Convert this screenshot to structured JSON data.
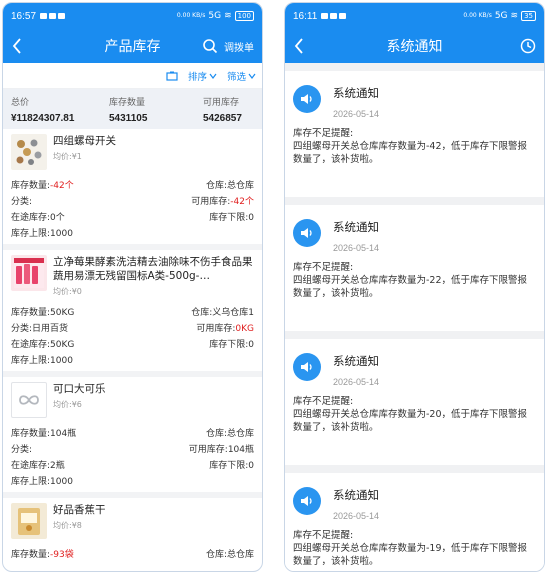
{
  "left": {
    "status": {
      "time": "16:57",
      "speed": "0.00 KB/s",
      "net": "5G",
      "battery": "100"
    },
    "nav": {
      "title": "产品库存",
      "transfer_label": "调拨单"
    },
    "toolbar": {
      "sort_label": "排序",
      "filter_label": "筛选"
    },
    "summary": {
      "total_label": "总价",
      "total_value": "¥11824307.81",
      "stock_label": "库存数量",
      "stock_value": "5431105",
      "avail_label": "可用库存",
      "avail_value": "5426857"
    },
    "products": [
      {
        "name": "四组螺母开关",
        "price": "均价:¥1",
        "rows": [
          [
            "库存数量:",
            "-42个",
            "仓库:总仓库",
            ""
          ],
          [
            "分类:",
            "",
            "可用库存:",
            "-42个"
          ],
          [
            "在途库存:0个",
            "",
            "库存下限:0",
            ""
          ],
          [
            "库存上限:1000",
            "",
            "",
            ""
          ]
        ]
      },
      {
        "name": "立净莓果酵素洗洁精去油除味不伤手食品果蔬用易漂无残留国标A类-500g-…",
        "price": "均价:¥0",
        "rows": [
          [
            "库存数量:50KG",
            "",
            "仓库:义乌仓库1",
            ""
          ],
          [
            "分类:日用百货",
            "",
            "可用库存:",
            "0KG"
          ],
          [
            "在途库存:50KG",
            "",
            "库存下限:0",
            ""
          ],
          [
            "库存上限:1000",
            "",
            "",
            ""
          ]
        ]
      },
      {
        "name": "可口大可乐",
        "price": "均价:¥6",
        "rows": [
          [
            "库存数量:104瓶",
            "",
            "仓库:总仓库",
            ""
          ],
          [
            "分类:",
            "",
            "可用库存:104瓶",
            ""
          ],
          [
            "在途库存:2瓶",
            "",
            "库存下限:0",
            ""
          ],
          [
            "库存上限:1000",
            "",
            "",
            ""
          ]
        ]
      },
      {
        "name": "好品香蕉干",
        "price": "均价:¥8",
        "rows": [
          [
            "库存数量:",
            "-93袋",
            "仓库:总仓库",
            ""
          ]
        ]
      }
    ]
  },
  "right": {
    "status": {
      "time": "16:11",
      "speed": "0.00 KB/s",
      "net": "5G",
      "battery": "35"
    },
    "nav": {
      "title": "系统通知"
    },
    "notices": [
      {
        "title": "系统通知",
        "date": "2026-05-14",
        "line1": "库存不足提醒:",
        "line2": "四组螺母开关总仓库库存数量为-42，低于库存下限警报数量了，该补货啦。"
      },
      {
        "title": "系统通知",
        "date": "2026-05-14",
        "line1": "库存不足提醒:",
        "line2": "四组螺母开关总仓库库存数量为-22，低于库存下限警报数量了，该补货啦。"
      },
      {
        "title": "系统通知",
        "date": "2026-05-14",
        "line1": "库存不足提醒:",
        "line2": "四组螺母开关总仓库库存数量为-20，低于库存下限警报数量了，该补货啦。"
      },
      {
        "title": "系统通知",
        "date": "2026-05-14",
        "line1": "库存不足提醒:",
        "line2": "四组螺母开关总仓库库存数量为-19，低于库存下限警报数量了，该补货啦。"
      }
    ]
  },
  "colors": {
    "primary": "#1a8cf0",
    "negative": "#e02020",
    "summary_bg": "#eef1f6"
  }
}
